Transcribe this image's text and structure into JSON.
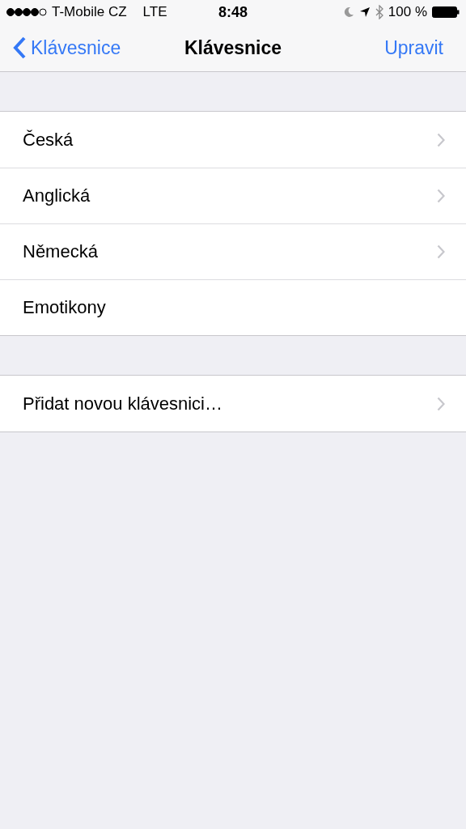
{
  "status_bar": {
    "carrier": "T-Mobile CZ",
    "network": "LTE",
    "time": "8:48",
    "battery": "100 %"
  },
  "nav_bar": {
    "back": "Klávesnice",
    "title": "Klávesnice",
    "action": "Upravit"
  },
  "sections": [
    {
      "rows": [
        {
          "label": "Česká",
          "chevron": true
        },
        {
          "label": "Anglická",
          "chevron": true
        },
        {
          "label": "Německá",
          "chevron": true
        },
        {
          "label": "Emotikony",
          "chevron": false
        }
      ]
    },
    {
      "rows": [
        {
          "label": "Přidat novou klávesnici…",
          "chevron": true
        }
      ]
    }
  ]
}
